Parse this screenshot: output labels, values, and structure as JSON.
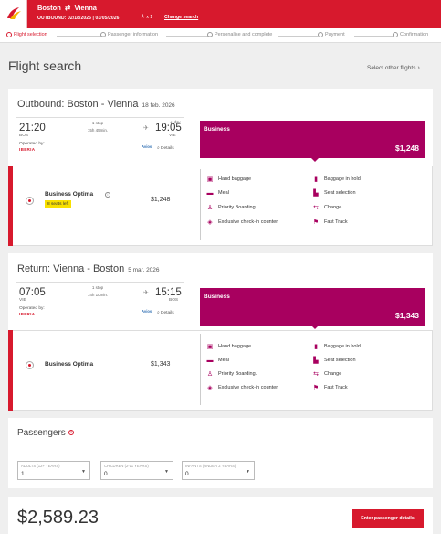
{
  "header": {
    "route_from": "Boston",
    "route_to": "Vienna",
    "dates": "OUTBOUND: 02/18/2026 | 03/05/2026",
    "pax_count": "x 1",
    "change_search": "Change search"
  },
  "steps": [
    {
      "label": "Flight selection",
      "active": true
    },
    {
      "label": "Passenger information",
      "active": false
    },
    {
      "label": "Personalise and complete",
      "active": false
    },
    {
      "label": "Payment",
      "active": false
    },
    {
      "label": "Confirmation",
      "active": false
    }
  ],
  "page_title": "Flight search",
  "select_other": "Select other flights",
  "outbound": {
    "title": "Outbound: Boston - Vienna",
    "date": "18 feb. 2026",
    "dep_time": "21:20",
    "dep_iata": "BOS",
    "arr_time": "19:05",
    "arr_iata": "VIE",
    "next_day": "+1day",
    "stops": "1 stop",
    "duration": "15h 45min.",
    "operated_by": "Operated by:",
    "operator": "IBERIA",
    "avios": "Avios",
    "details": "Details",
    "fare_class": "Business",
    "fare_price": "$1,248",
    "fare_name": "Business Optima",
    "seats_left": "8 seats left",
    "fare_price_detail": "$1,248"
  },
  "return": {
    "title": "Return: Vienna - Boston",
    "date": "5 mar. 2026",
    "dep_time": "07:05",
    "dep_iata": "VIE",
    "arr_time": "15:15",
    "arr_iata": "BOS",
    "stops": "1 stop",
    "duration": "14h 10min.",
    "operated_by": "Operated by:",
    "operator": "IBERIA",
    "avios": "Avios",
    "details": "Details",
    "fare_class": "Business",
    "fare_price": "$1,343",
    "fare_name": "Business Optima",
    "fare_price_detail": "$1,343"
  },
  "features": [
    {
      "label": "Hand baggage",
      "icon": "hand-baggage-icon"
    },
    {
      "label": "Baggage in hold",
      "icon": "hold-baggage-icon"
    },
    {
      "label": "Meal",
      "icon": "meal-icon"
    },
    {
      "label": "Seat selection",
      "icon": "seat-icon"
    },
    {
      "label": "Priority Boarding.",
      "icon": "priority-boarding-icon"
    },
    {
      "label": "Change",
      "icon": "change-icon"
    },
    {
      "label": "Exclusive check-in counter",
      "icon": "check-in-icon"
    },
    {
      "label": "Fast Track",
      "icon": "fast-track-icon"
    }
  ],
  "passengers": {
    "title": "Passengers",
    "adults_label": "ADULTS (12+ YEARS)",
    "adults_value": "1",
    "children_label": "CHILDREN (2-11 YEARS)",
    "children_value": "0",
    "infants_label": "INFANTS (UNDER 2 YEARS)",
    "infants_value": "0"
  },
  "total": "$2,589.23",
  "cta": "Enter passenger details",
  "colors": {
    "brand_red": "#d7192d",
    "business_purple": "#a8005f",
    "seats_yellow": "#f8e000"
  }
}
